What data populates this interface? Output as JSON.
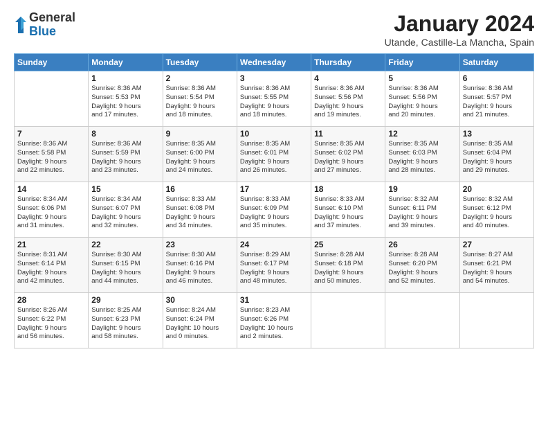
{
  "header": {
    "logo_general": "General",
    "logo_blue": "Blue",
    "month_title": "January 2024",
    "location": "Utande, Castille-La Mancha, Spain"
  },
  "weekdays": [
    "Sunday",
    "Monday",
    "Tuesday",
    "Wednesday",
    "Thursday",
    "Friday",
    "Saturday"
  ],
  "weeks": [
    [
      {
        "day": "",
        "content": ""
      },
      {
        "day": "1",
        "content": "Sunrise: 8:36 AM\nSunset: 5:53 PM\nDaylight: 9 hours\nand 17 minutes."
      },
      {
        "day": "2",
        "content": "Sunrise: 8:36 AM\nSunset: 5:54 PM\nDaylight: 9 hours\nand 18 minutes."
      },
      {
        "day": "3",
        "content": "Sunrise: 8:36 AM\nSunset: 5:55 PM\nDaylight: 9 hours\nand 18 minutes."
      },
      {
        "day": "4",
        "content": "Sunrise: 8:36 AM\nSunset: 5:56 PM\nDaylight: 9 hours\nand 19 minutes."
      },
      {
        "day": "5",
        "content": "Sunrise: 8:36 AM\nSunset: 5:56 PM\nDaylight: 9 hours\nand 20 minutes."
      },
      {
        "day": "6",
        "content": "Sunrise: 8:36 AM\nSunset: 5:57 PM\nDaylight: 9 hours\nand 21 minutes."
      }
    ],
    [
      {
        "day": "7",
        "content": "Sunrise: 8:36 AM\nSunset: 5:58 PM\nDaylight: 9 hours\nand 22 minutes."
      },
      {
        "day": "8",
        "content": "Sunrise: 8:36 AM\nSunset: 5:59 PM\nDaylight: 9 hours\nand 23 minutes."
      },
      {
        "day": "9",
        "content": "Sunrise: 8:35 AM\nSunset: 6:00 PM\nDaylight: 9 hours\nand 24 minutes."
      },
      {
        "day": "10",
        "content": "Sunrise: 8:35 AM\nSunset: 6:01 PM\nDaylight: 9 hours\nand 26 minutes."
      },
      {
        "day": "11",
        "content": "Sunrise: 8:35 AM\nSunset: 6:02 PM\nDaylight: 9 hours\nand 27 minutes."
      },
      {
        "day": "12",
        "content": "Sunrise: 8:35 AM\nSunset: 6:03 PM\nDaylight: 9 hours\nand 28 minutes."
      },
      {
        "day": "13",
        "content": "Sunrise: 8:35 AM\nSunset: 6:04 PM\nDaylight: 9 hours\nand 29 minutes."
      }
    ],
    [
      {
        "day": "14",
        "content": "Sunrise: 8:34 AM\nSunset: 6:06 PM\nDaylight: 9 hours\nand 31 minutes."
      },
      {
        "day": "15",
        "content": "Sunrise: 8:34 AM\nSunset: 6:07 PM\nDaylight: 9 hours\nand 32 minutes."
      },
      {
        "day": "16",
        "content": "Sunrise: 8:33 AM\nSunset: 6:08 PM\nDaylight: 9 hours\nand 34 minutes."
      },
      {
        "day": "17",
        "content": "Sunrise: 8:33 AM\nSunset: 6:09 PM\nDaylight: 9 hours\nand 35 minutes."
      },
      {
        "day": "18",
        "content": "Sunrise: 8:33 AM\nSunset: 6:10 PM\nDaylight: 9 hours\nand 37 minutes."
      },
      {
        "day": "19",
        "content": "Sunrise: 8:32 AM\nSunset: 6:11 PM\nDaylight: 9 hours\nand 39 minutes."
      },
      {
        "day": "20",
        "content": "Sunrise: 8:32 AM\nSunset: 6:12 PM\nDaylight: 9 hours\nand 40 minutes."
      }
    ],
    [
      {
        "day": "21",
        "content": "Sunrise: 8:31 AM\nSunset: 6:14 PM\nDaylight: 9 hours\nand 42 minutes."
      },
      {
        "day": "22",
        "content": "Sunrise: 8:30 AM\nSunset: 6:15 PM\nDaylight: 9 hours\nand 44 minutes."
      },
      {
        "day": "23",
        "content": "Sunrise: 8:30 AM\nSunset: 6:16 PM\nDaylight: 9 hours\nand 46 minutes."
      },
      {
        "day": "24",
        "content": "Sunrise: 8:29 AM\nSunset: 6:17 PM\nDaylight: 9 hours\nand 48 minutes."
      },
      {
        "day": "25",
        "content": "Sunrise: 8:28 AM\nSunset: 6:18 PM\nDaylight: 9 hours\nand 50 minutes."
      },
      {
        "day": "26",
        "content": "Sunrise: 8:28 AM\nSunset: 6:20 PM\nDaylight: 9 hours\nand 52 minutes."
      },
      {
        "day": "27",
        "content": "Sunrise: 8:27 AM\nSunset: 6:21 PM\nDaylight: 9 hours\nand 54 minutes."
      }
    ],
    [
      {
        "day": "28",
        "content": "Sunrise: 8:26 AM\nSunset: 6:22 PM\nDaylight: 9 hours\nand 56 minutes."
      },
      {
        "day": "29",
        "content": "Sunrise: 8:25 AM\nSunset: 6:23 PM\nDaylight: 9 hours\nand 58 minutes."
      },
      {
        "day": "30",
        "content": "Sunrise: 8:24 AM\nSunset: 6:24 PM\nDaylight: 10 hours\nand 0 minutes."
      },
      {
        "day": "31",
        "content": "Sunrise: 8:23 AM\nSunset: 6:26 PM\nDaylight: 10 hours\nand 2 minutes."
      },
      {
        "day": "",
        "content": ""
      },
      {
        "day": "",
        "content": ""
      },
      {
        "day": "",
        "content": ""
      }
    ]
  ]
}
